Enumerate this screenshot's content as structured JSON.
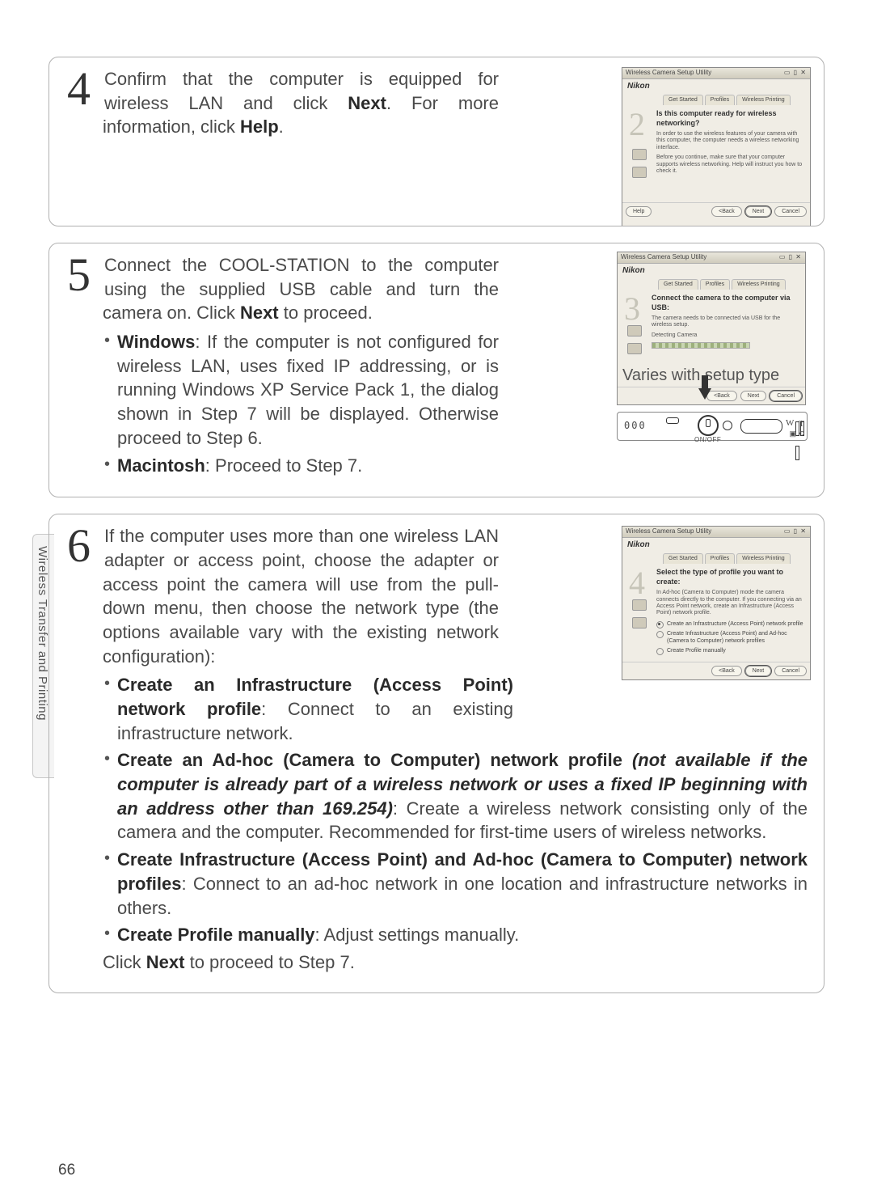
{
  "page_number": "66",
  "side_tab": "Wireless Transfer and Printing",
  "step4": {
    "num": "4",
    "line1_a": "Confirm that the computer is equipped for wireless LAN and click ",
    "line1_next": "Next",
    "line1_b": ". For more information, click ",
    "line1_help": "Help",
    "line1_c": "."
  },
  "step5": {
    "num": "5",
    "main_a": "Connect the COOL-STATION to the computer using the supplied USB cable and turn the camera on. Click ",
    "main_next": "Next",
    "main_b": " to proceed.",
    "win_label": "Windows",
    "win_text": ": If the computer is not configured for wireless LAN, uses fixed IP addressing, or is running Windows XP Service Pack 1, the dialog shown in Step 7 will be displayed. Otherwise proceed to Step 6.",
    "mac_label": "Macintosh",
    "mac_text": ": Proceed to Step 7.",
    "varies": "Varies with setup type",
    "camera_lcd": "000",
    "onoff": "ON/OFF"
  },
  "step6": {
    "num": "6",
    "intro": "If the computer uses more than one wireless LAN adapter or access point, choose the adapter or access point the camera will use from the pull-down menu, then choose the network type (the options available vary with the existing network configuration):",
    "b1_label": "Create an Infrastructure (Access Point) network profile",
    "b1_text": ": Connect to an existing infrastructure network.",
    "b2_label": "Create an Ad-hoc (Camera to Computer) network profile",
    "b2_ital": " (not available if the computer is already part of a wireless network or uses a fixed IP beginning with an address other than 169.254)",
    "b2_text": ": Create a wireless network consisting only of the camera and the computer. Recommended for first-time users of wireless networks.",
    "b3_label": "Create Infrastructure (Access Point) and Ad-hoc (Camera to Computer) network profiles",
    "b3_text": ": Connect to an ad-hoc network in one location and infrastructure networks in others.",
    "b4_label": "Create Profile manually",
    "b4_text": ": Adjust settings manually.",
    "closing_a": "Click ",
    "closing_next": "Next",
    "closing_b": " to proceed to Step 7."
  },
  "dialog": {
    "title": "Wireless Camera Setup Utility",
    "logo": "Nikon",
    "tabs": {
      "a": "Get Started",
      "b": "Profiles",
      "c": "Wireless Printing"
    },
    "help": "Help",
    "back": "<Back",
    "next": "Next",
    "cancel": "Cancel",
    "s2": {
      "bignum": "2",
      "head": "Is this computer ready for wireless networking?",
      "t1": "In order to use the wireless features of your camera with this computer, the computer needs a wireless networking interface.",
      "t2": "Before you continue, make sure that your computer supports wireless networking. Help will instruct you how to check it."
    },
    "s3": {
      "bignum": "3",
      "head": "Connect the camera to the computer via USB:",
      "t1": "The camera needs to be connected via USB for the wireless setup.",
      "det": "Detecting Camera"
    },
    "s4": {
      "bignum": "4",
      "head": "Select the type of profile you want to create:",
      "t1": "In Ad-hoc (Camera to Computer) mode the camera connects directly to the computer. If you connecting via an Access Point network, create an Infrastructure (Access Point) network profile.",
      "r1": "Create an Infrastructure (Access Point) network profile",
      "r2": "Create Infrastructure (Access Point) and Ad-hoc (Camera to Computer) network profiles",
      "r3": "Create Profile manually"
    }
  }
}
